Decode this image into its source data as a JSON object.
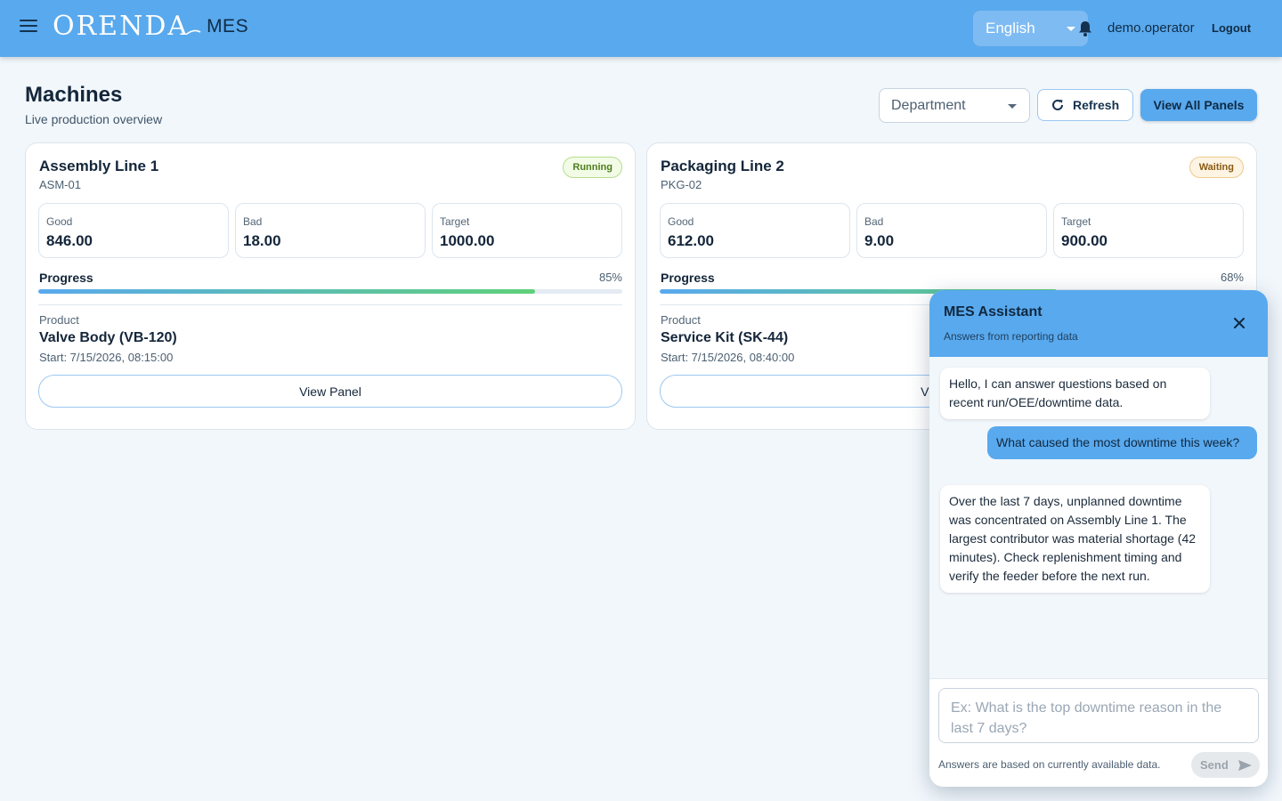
{
  "header": {
    "logo_word": "ORENDA",
    "logo_suffix": "MES",
    "language": "English",
    "username": "demo.operator",
    "logout_label": "Logout"
  },
  "page": {
    "title": "Machines",
    "subtitle": "Live production overview",
    "department_placeholder": "Department",
    "refresh_label": "Refresh",
    "view_all_label": "View All Panels"
  },
  "machines": [
    {
      "name": "Assembly Line 1",
      "code": "ASM-01",
      "status": "Running",
      "good_label": "Good",
      "good": "846.00",
      "bad_label": "Bad",
      "bad": "18.00",
      "target_label": "Target",
      "target": "1000.00",
      "progress_label": "Progress",
      "progress_text": "85%",
      "progress": 0.85,
      "product_label": "Product",
      "product": "Valve Body (VB-120)",
      "start": "Start: 7/15/2026, 08:15:00",
      "view_label": "View Panel"
    },
    {
      "name": "Packaging Line 2",
      "code": "PKG-02",
      "status": "Waiting",
      "good_label": "Good",
      "good": "612.00",
      "bad_label": "Bad",
      "bad": "9.00",
      "target_label": "Target",
      "target": "900.00",
      "progress_label": "Progress",
      "progress_text": "68%",
      "progress": 0.68,
      "product_label": "Product",
      "product": "Service Kit (SK-44)",
      "start": "Start: 7/15/2026, 08:40:00",
      "view_label": "View Panel"
    }
  ],
  "assistant": {
    "title": "MES Assistant",
    "subtitle": "Answers from reporting data",
    "messages": [
      {
        "role": "bot",
        "text": "Hello, I can answer questions based on recent run/OEE/downtime data."
      },
      {
        "role": "user",
        "text": "What caused the most downtime this week?"
      },
      {
        "role": "bot",
        "text": "Over the last 7 days, unplanned downtime was concentrated on Assembly Line 1. The largest contributor was material shortage (42 minutes). Check replenishment timing and verify the feeder before the next run."
      }
    ],
    "input_placeholder": "Ex: What is the top downtime reason in the last 7 days?",
    "note": "Answers are based on currently available data.",
    "send_label": "Send"
  },
  "colors": {
    "primary": "#59a9ee",
    "running": "#4e7d1e",
    "waiting": "#8a5a12"
  }
}
